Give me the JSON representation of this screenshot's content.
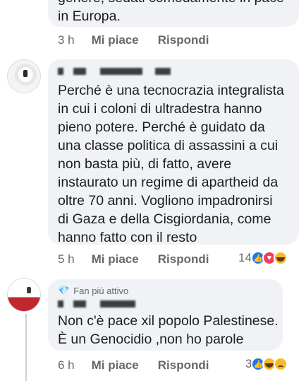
{
  "comments": [
    {
      "text": "genere, sedati comodamente in pace\nin Europa.",
      "actions": {
        "time": "3 h",
        "like": "Mi piace",
        "reply": "Rispondi"
      }
    },
    {
      "text": "Perché è una tecnocrazia integralista\nin cui i coloni di ultradestra hanno\npieno potere. Perché è guidato da\nuna classe politica di assassini a cui\nnon basta più, di fatto, avere\ninstaurato un regime di apartheid da\noltre 70 anni. Vogliono impadronirsi\ndi Gaza e della Cisgiordania, come\nhanno fatto con il resto",
      "actions": {
        "time": "5 h",
        "like": "Mi piace",
        "reply": "Rispondi"
      },
      "reaction_count": "14",
      "reactions": [
        "like-icon",
        "love-icon",
        "haha-icon"
      ]
    },
    {
      "badge": "Fan più attivo",
      "badge_icon": "💎",
      "text": "Non c'è pace xil popolo Palestinese.\nÈ un Genocidio ,non ho parole",
      "actions": {
        "time": "6 h",
        "like": "Mi piace",
        "reply": "Rispondi"
      },
      "reaction_count": "3",
      "reactions": [
        "like-icon",
        "haha-icon",
        "sad-icon"
      ]
    }
  ],
  "colors": {
    "bubble": "#f0f2f5",
    "meta_text": "#65676b",
    "like": "#1877f2",
    "love": "#f33e58",
    "emoji": "#f7b928"
  }
}
